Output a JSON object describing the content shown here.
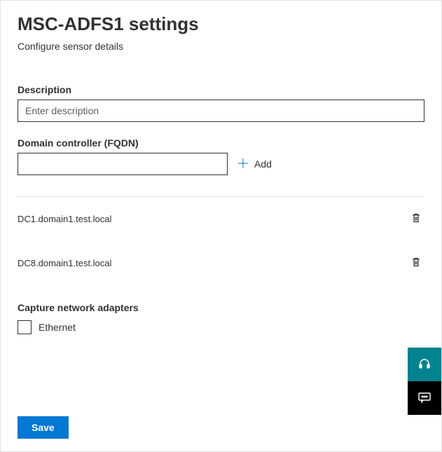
{
  "title": "MSC-ADFS1 settings",
  "subtitle": "Configure sensor details",
  "description": {
    "label": "Description",
    "placeholder": "Enter description",
    "value": ""
  },
  "fqdn": {
    "label": "Domain controller (FQDN)",
    "value": "",
    "addLabel": "Add"
  },
  "domainControllers": [
    {
      "name": "DC1.domain1.test.local"
    },
    {
      "name": "DC8.domain1.test.local"
    }
  ],
  "adapters": {
    "label": "Capture network adapters",
    "items": [
      {
        "label": "Ethernet",
        "checked": false
      }
    ]
  },
  "saveLabel": "Save"
}
